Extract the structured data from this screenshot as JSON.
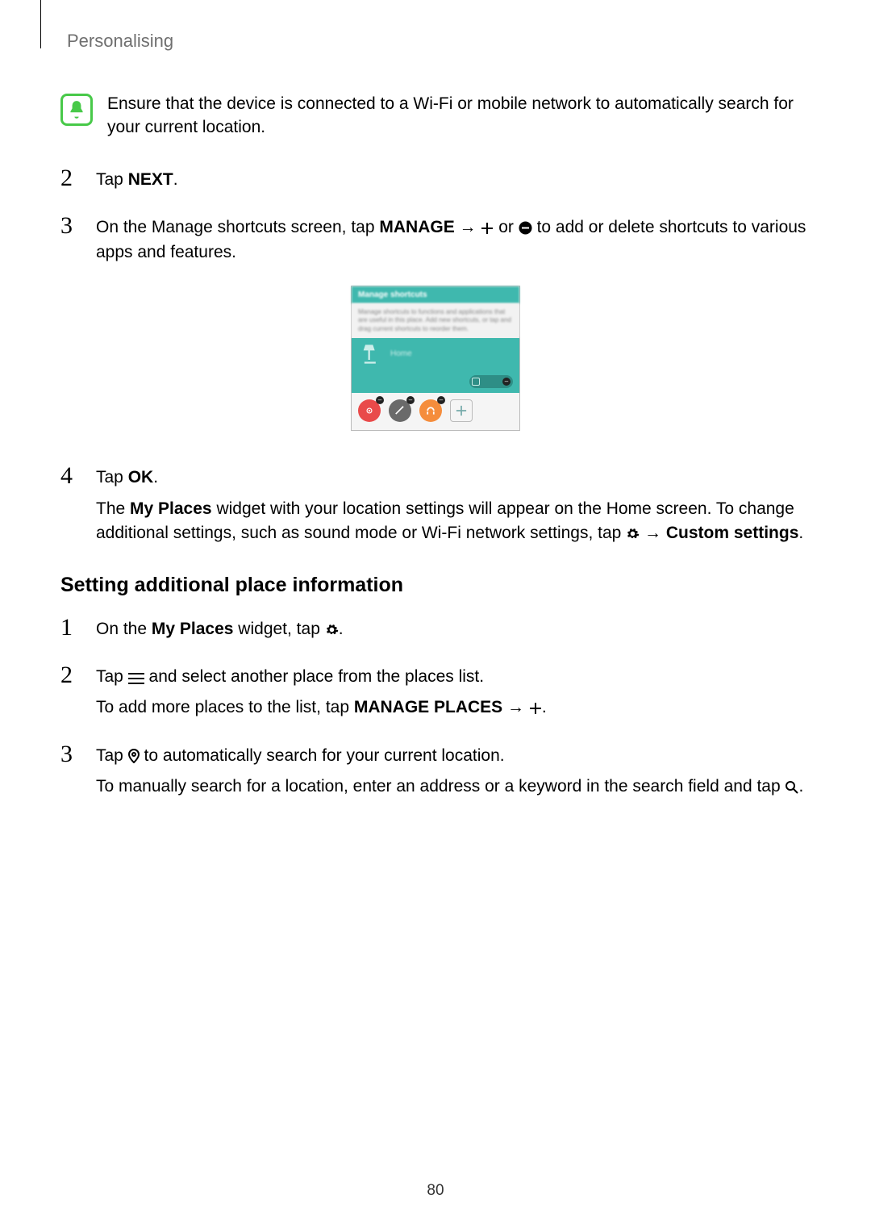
{
  "sectionTitle": "Personalising",
  "note": {
    "pre": "Ensure that the device is connected to a ",
    "mid": "Wi-Fi",
    "post": " or mobile network to automatically search for your current location."
  },
  "stepsA": {
    "s2": {
      "num": "2",
      "t1": "Tap ",
      "next": "NEXT",
      "t2": "."
    },
    "s3": {
      "num": "3",
      "t1": "On the Manage shortcuts screen, tap ",
      "manage": "MANAGE",
      "arrow": " → ",
      "t2": " or ",
      "t3": " to add or delete shortcuts to various apps and features."
    },
    "s4": {
      "num": "4",
      "t1": "Tap ",
      "ok": "OK",
      "t2": ".",
      "p1a": "The ",
      "myplaces": "My Places",
      "p1b": " widget with your location settings will appear on the Home screen. To change additional settings, such as sound mode or ",
      "wifi": "Wi-Fi",
      "p1c": " network settings, tap ",
      "arrow": " → ",
      "custom": "Custom settings",
      "p1d": "."
    }
  },
  "h3": "Setting additional place information",
  "stepsB": {
    "s1": {
      "num": "1",
      "t1": "On the ",
      "myplaces": "My Places",
      "t2": " widget, tap ",
      "t3": "."
    },
    "s2": {
      "num": "2",
      "l1a": "Tap ",
      "l1b": " and select another place from the places list.",
      "l2a": "To add more places to the list, tap ",
      "manageplaces": "MANAGE PLACES",
      "arrow": " → ",
      "l2b": "."
    },
    "s3": {
      "num": "3",
      "l1a": "Tap ",
      "l1b": " to automatically search for your current location.",
      "l2a": "To manually search for a location, enter an address or a keyword in the search field and tap ",
      "l2b": "."
    }
  },
  "screenshot": {
    "header": "Manage shortcuts",
    "desc": "Manage shortcuts to functions and applications that are useful in this place. Add new shortcuts, or tap and drag current shortcuts to reorder them.",
    "home": "Home"
  },
  "pageNumber": "80"
}
